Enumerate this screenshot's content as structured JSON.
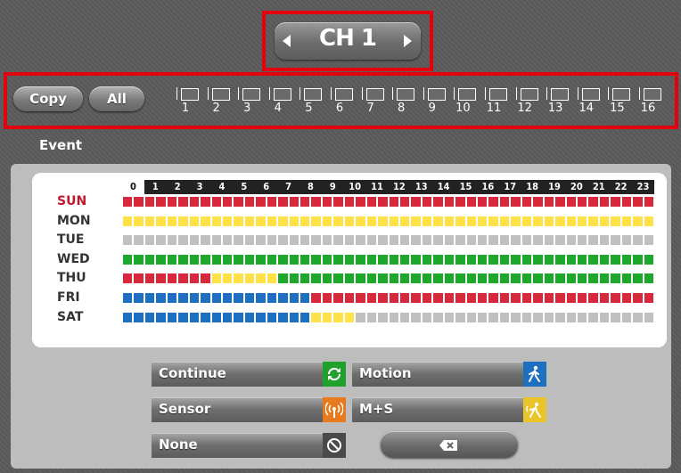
{
  "channel": {
    "label": "CH 1"
  },
  "copy_row": {
    "copy_label": "Copy",
    "all_label": "All",
    "channels": [
      "1",
      "2",
      "3",
      "4",
      "5",
      "6",
      "7",
      "8",
      "9",
      "10",
      "11",
      "12",
      "13",
      "14",
      "15",
      "16"
    ]
  },
  "event_title": "Event",
  "hours": [
    "0",
    "1",
    "2",
    "3",
    "4",
    "5",
    "6",
    "7",
    "8",
    "9",
    "10",
    "11",
    "12",
    "13",
    "14",
    "15",
    "16",
    "17",
    "18",
    "19",
    "20",
    "21",
    "22",
    "23"
  ],
  "colors": {
    "continue": "#d8283c",
    "motion": "#1d6fbf",
    "sensor": "#ffe24a",
    "motion_sensor": "#1ca82a",
    "none": "#c0c0c0"
  },
  "schedule": [
    {
      "day": "SUN",
      "segments": [
        {
          "mode": "continue",
          "slots": 48
        }
      ]
    },
    {
      "day": "MON",
      "segments": [
        {
          "mode": "sensor",
          "slots": 48
        }
      ]
    },
    {
      "day": "TUE",
      "segments": [
        {
          "mode": "none",
          "slots": 48
        }
      ]
    },
    {
      "day": "WED",
      "segments": [
        {
          "mode": "motion_sensor",
          "slots": 48
        }
      ]
    },
    {
      "day": "THU",
      "segments": [
        {
          "mode": "continue",
          "slots": 8
        },
        {
          "mode": "sensor",
          "slots": 6
        },
        {
          "mode": "motion_sensor",
          "slots": 34
        }
      ]
    },
    {
      "day": "FRI",
      "segments": [
        {
          "mode": "motion",
          "slots": 17
        },
        {
          "mode": "continue",
          "slots": 31
        }
      ]
    },
    {
      "day": "SAT",
      "segments": [
        {
          "mode": "motion",
          "slots": 17
        },
        {
          "mode": "sensor",
          "slots": 4
        },
        {
          "mode": "none",
          "slots": 27
        }
      ]
    }
  ],
  "legend": {
    "continue": {
      "label": "Continue",
      "icon": "refresh-icon"
    },
    "motion": {
      "label": "Motion",
      "icon": "walking-person-icon"
    },
    "sensor": {
      "label": "Sensor",
      "icon": "sensor-signal-icon"
    },
    "motion_sensor": {
      "label": "M+S",
      "icon": "motion-sensor-icon"
    },
    "none": {
      "label": "None",
      "icon": "prohibited-icon"
    }
  }
}
